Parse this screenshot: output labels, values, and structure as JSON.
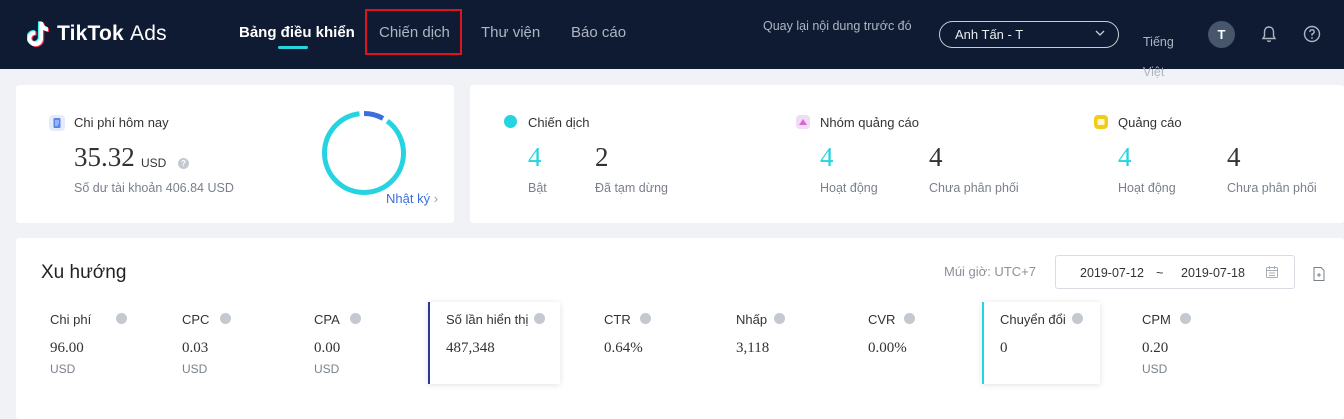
{
  "header": {
    "logo_text": "TikTok",
    "logo_suffix": "Ads",
    "nav": [
      {
        "label": "Bảng điều khiển",
        "active": true
      },
      {
        "label": "Chiến dịch",
        "active": false
      },
      {
        "label": "Thư viện",
        "active": false
      },
      {
        "label": "Báo cáo",
        "active": false
      }
    ],
    "back_link": "Quay lại nội dung trước đó",
    "account": "Anh Tấn - T",
    "language": "Tiếng Việt",
    "avatar_letter": "T",
    "icons": [
      "bell-icon",
      "help-circle-icon"
    ]
  },
  "spend_card": {
    "label": "Chi phí hôm nay",
    "amount": "35.32",
    "currency": "USD",
    "balance": "Số dư tài khoản 406.84 USD",
    "log_link": "Nhật ký",
    "ring_progress": 0.08
  },
  "status_card": {
    "groups": [
      {
        "title": "Chiến dịch",
        "active_value": "4",
        "active_label": "Bật",
        "other_value": "2",
        "other_label": "Đã tạm dừng",
        "icon_color": "#25d4e0"
      },
      {
        "title": "Nhóm quảng cáo",
        "active_value": "4",
        "active_label": "Hoạt động",
        "other_value": "4",
        "other_label": "Chưa phân phối",
        "icon_color": "#d36ad8"
      },
      {
        "title": "Quảng cáo",
        "active_value": "4",
        "active_label": "Hoạt động",
        "other_value": "4",
        "other_label": "Chưa phân phối",
        "icon_color": "#f2cc1b"
      }
    ]
  },
  "trend": {
    "title": "Xu hướng",
    "timezone": "Múi giờ: UTC+7",
    "date_from": "2019-07-12",
    "date_sep": "~",
    "date_to": "2019-07-18",
    "metrics": [
      {
        "label": "Chi phí",
        "value": "96.00",
        "unit": "USD"
      },
      {
        "label": "CPC",
        "value": "0.03",
        "unit": "USD"
      },
      {
        "label": "CPA",
        "value": "0.00",
        "unit": "USD"
      },
      {
        "label": "Số lần hiển thị",
        "value": "487,348",
        "unit": ""
      },
      {
        "label": "CTR",
        "value": "0.64%",
        "unit": ""
      },
      {
        "label": "Nhấp",
        "value": "3,118",
        "unit": ""
      },
      {
        "label": "CVR",
        "value": "0.00%",
        "unit": ""
      },
      {
        "label": "Chuyển đổi",
        "value": "0",
        "unit": ""
      },
      {
        "label": "CPM",
        "value": "0.20",
        "unit": "USD"
      }
    ]
  },
  "colors": {
    "nav_bg": "#0f1b33",
    "accent_cyan": "#25d4e0",
    "highlight_red": "#e0141e",
    "link_blue": "#3a6fdc",
    "selected_bar_navy": "#2a3a8c"
  }
}
